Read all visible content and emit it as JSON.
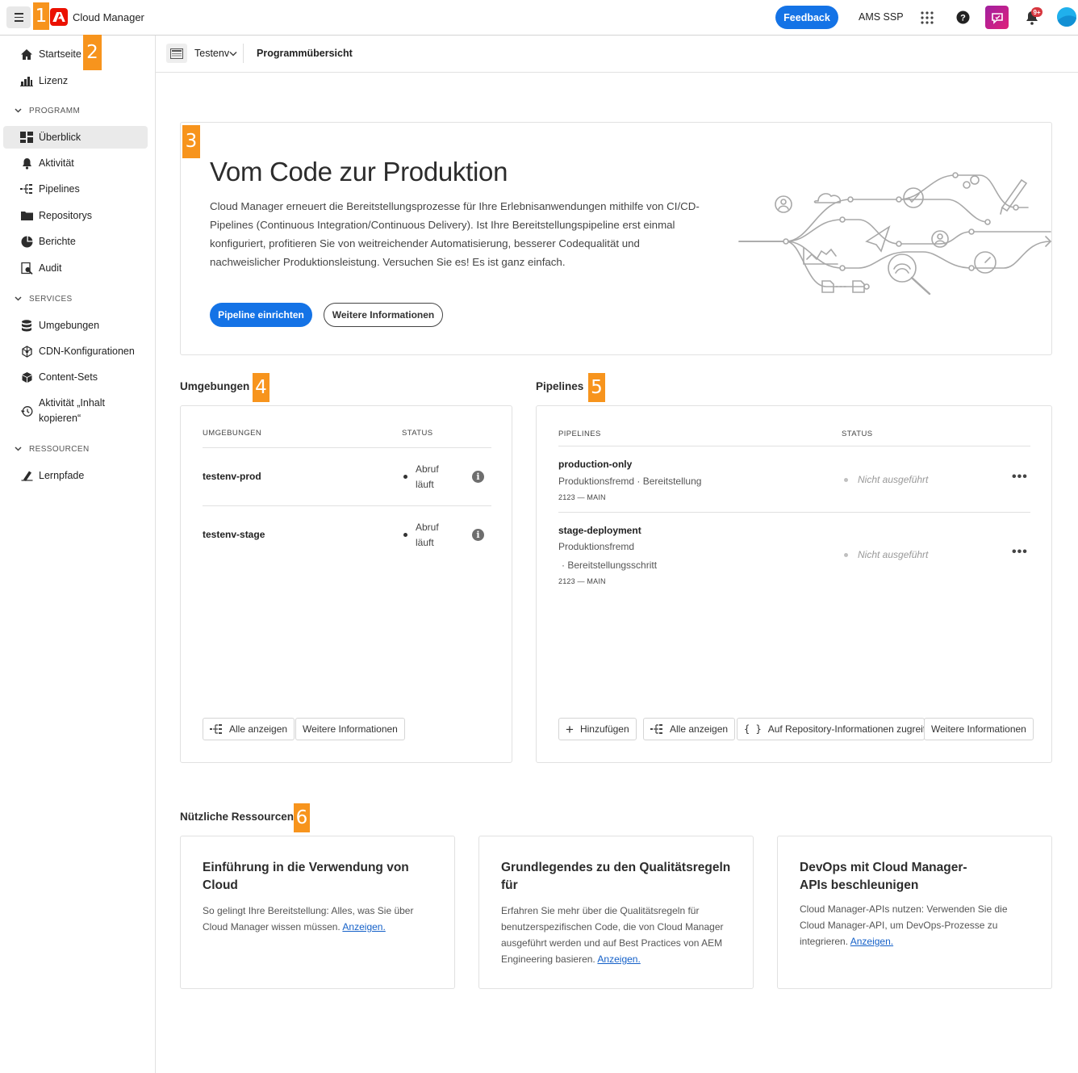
{
  "topbar": {
    "app_name": "Cloud Manager",
    "feedback_label": "Feedback",
    "org_name": "AMS SSP",
    "notification_badge": "9+"
  },
  "markers": [
    "1",
    "2",
    "3",
    "4",
    "5",
    "6"
  ],
  "sidebar": {
    "top_items": [
      {
        "label": "Startseite",
        "icon": "home-icon"
      },
      {
        "label": "Lizenz",
        "icon": "license-icon"
      }
    ],
    "sections": [
      {
        "title": "PROGRAMM",
        "items": [
          {
            "label": "Überblick",
            "icon": "overview-icon",
            "active": true
          },
          {
            "label": "Aktivität",
            "icon": "bell-icon"
          },
          {
            "label": "Pipelines",
            "icon": "pipelines-icon"
          },
          {
            "label": "Repositorys",
            "icon": "folder-icon"
          },
          {
            "label": "Berichte",
            "icon": "reports-icon"
          },
          {
            "label": "Audit",
            "icon": "audit-icon"
          }
        ]
      },
      {
        "title": "SERVICES",
        "items": [
          {
            "label": "Umgebungen",
            "icon": "database-icon"
          },
          {
            "label": "CDN-Konfigurationen",
            "icon": "cdn-icon"
          },
          {
            "label": "Content-Sets",
            "icon": "box-icon"
          },
          {
            "label": "Aktivität „Inhalt kopieren“",
            "icon": "history-icon"
          }
        ]
      },
      {
        "title": "RESSOURCEN",
        "items": [
          {
            "label": "Lernpfade",
            "icon": "learn-icon"
          }
        ]
      }
    ]
  },
  "breadcrumb": {
    "program_name": "Testenv",
    "page_title": "Programmübersicht"
  },
  "hero": {
    "title": "Vom Code zur Produktion",
    "description": "Cloud Manager erneuert die Bereitstellungsprozesse für Ihre Erlebnisanwendungen mithilfe von CI/CD-Pipelines (Continuous Integration/Continuous Delivery). Ist Ihre Bereitstellungspipeline erst einmal konfiguriert, profitieren Sie von weitreichender Automatisierung, besserer Codequalität und nachweislicher Produktionsleistung. Versuchen Sie es! Es ist ganz einfach.",
    "primary_button": "Pipeline einrichten",
    "secondary_button": "Weitere Informationen"
  },
  "environments": {
    "section_title": "Umgebungen",
    "col_name": "UMGEBUNGEN",
    "col_status": "STATUS",
    "rows": [
      {
        "name": "testenv-prod",
        "status_line1": "Abruf",
        "status_line2": "läuft"
      },
      {
        "name": "testenv-stage",
        "status_line1": "Abruf",
        "status_line2": "läuft"
      }
    ],
    "btn_all": "Alle anzeigen",
    "btn_more": "Weitere Informationen"
  },
  "pipelines": {
    "section_title": "Pipelines",
    "col_name": "PIPELINES",
    "col_status": "STATUS",
    "rows": [
      {
        "name": "production-only",
        "type": "Produktionsfremd",
        "kind": "Bereitstellung",
        "meta": "2123 — MAIN",
        "status": "Nicht ausgeführt"
      },
      {
        "name": "stage-deployment",
        "type": "Produktionsfremd",
        "kind": "Bereitstellungsschritt",
        "meta": "2123 — MAIN",
        "status": "Nicht ausgeführt"
      }
    ],
    "btn_add": "Hinzufügen",
    "btn_all": "Alle anzeigen",
    "btn_repo": "Auf Repository-Informationen zugreifen",
    "btn_more": "Weitere Informationen"
  },
  "resources": {
    "section_title": "Nützliche Ressourcen",
    "cards": [
      {
        "title": "Einführung in die Verwendung von Cloud",
        "body": "So gelingt Ihre Bereitstellung: Alles, was Sie über Cloud Manager wissen müssen.",
        "link": "Anzeigen."
      },
      {
        "title": "Grundlegendes zu den Qualitätsregeln für",
        "body": "Erfahren Sie mehr über die Qualitätsregeln für benutzerspezifischen Code, die von Cloud Manager ausgeführt werden und auf Best Practices von AEM Engineering basieren.",
        "link": "Anzeigen."
      },
      {
        "title": "DevOps mit Cloud Manager-APIs beschleunigen",
        "body": "Cloud Manager-APIs nutzen: Verwenden Sie die Cloud Manager-API, um DevOps-Prozesse zu integrieren.",
        "link": "Anzeigen."
      }
    ]
  },
  "colors": {
    "accent": "#1473e6",
    "marker": "#f7941d",
    "adobe_red": "#eb1000"
  }
}
